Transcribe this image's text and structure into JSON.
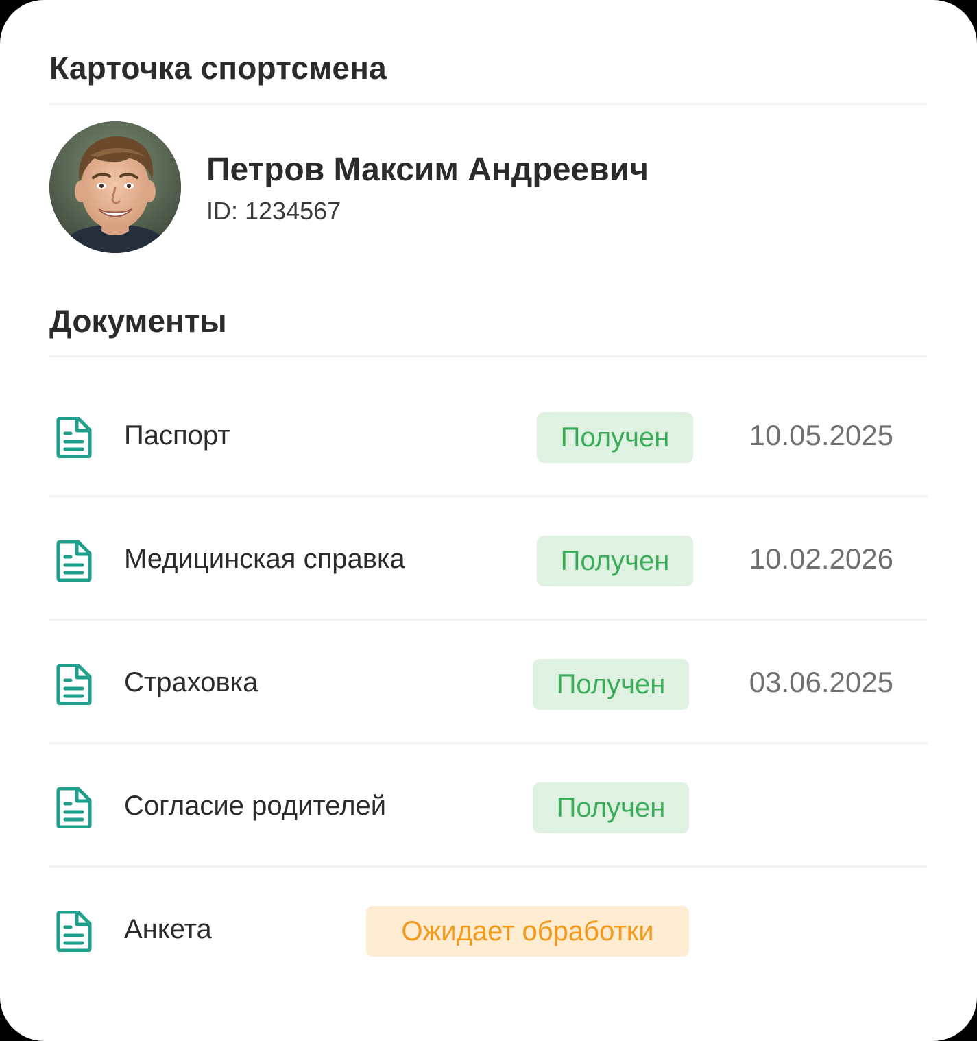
{
  "card": {
    "title": "Карточка спортсмена"
  },
  "athlete": {
    "name": "Петров Максим Андреевич",
    "id_text": "ID: 1234567"
  },
  "documents": {
    "title": "Документы",
    "icon": "file-text-icon",
    "icon_color": "#1f9e8c",
    "items": [
      {
        "name": "Паспорт",
        "status": "Получен",
        "status_kind": "received",
        "date": "10.05.2025"
      },
      {
        "name": "Медицинская справка",
        "status": "Получен",
        "status_kind": "received",
        "date": "10.02.2026"
      },
      {
        "name": "Страховка",
        "status": "Получен",
        "status_kind": "received",
        "date": "03.06.2025"
      },
      {
        "name": "Согласие родителей",
        "status": "Получен",
        "status_kind": "received",
        "date": ""
      },
      {
        "name": "Анкета",
        "status": "Ожидает обработки",
        "status_kind": "pending",
        "date": ""
      }
    ]
  },
  "colors": {
    "received_bg": "#dff1e1",
    "received_text": "#3bad5a",
    "pending_bg": "#fdebd2",
    "pending_text": "#f29a1c"
  }
}
